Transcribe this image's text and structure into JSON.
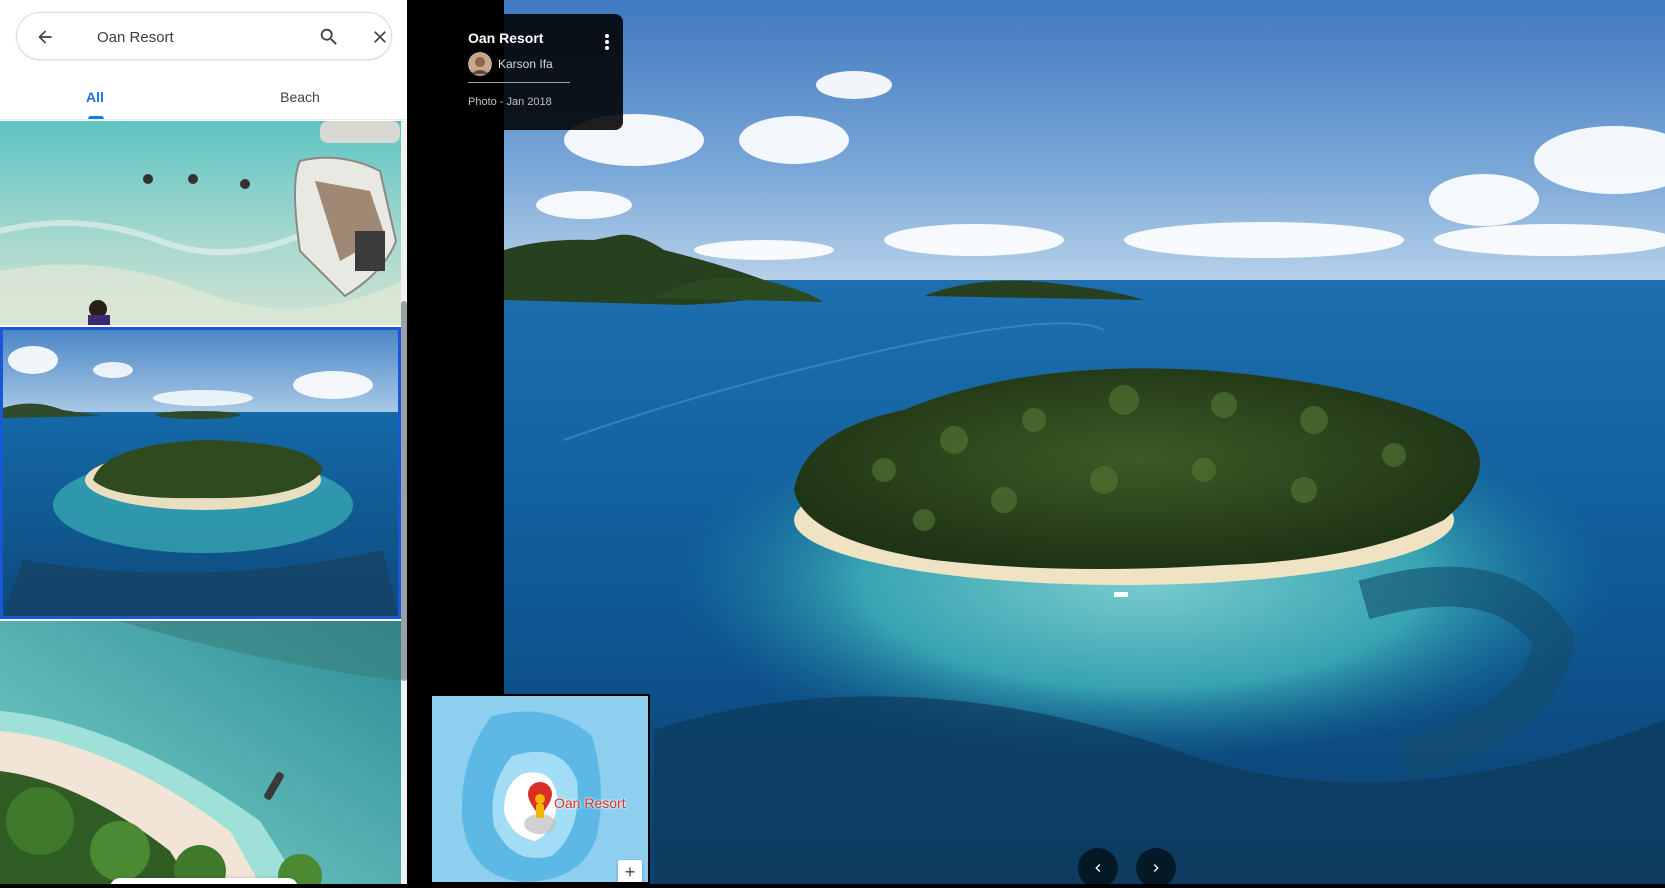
{
  "search": {
    "value": "Oan Resort",
    "back_icon": "arrow-left-icon",
    "search_icon": "search-icon",
    "close_icon": "close-icon"
  },
  "tabs": [
    {
      "label": "All",
      "active": true
    },
    {
      "label": "Beach",
      "active": false
    }
  ],
  "thumbnails": [
    {
      "description_icon": "beach-swimmers-photo",
      "selected": false
    },
    {
      "description_icon": "island-aerial-photo",
      "selected": true
    },
    {
      "description_icon": "beach-palms-photo",
      "selected": false
    }
  ],
  "photo_info": {
    "title": "Oan Resort",
    "author": "Karson Ifa",
    "meta": "Photo - Jan 2018",
    "more_icon": "more-vert-icon"
  },
  "minimap": {
    "place_label": "Oan Resort",
    "zoom_in_label": "+"
  },
  "navigation": {
    "prev_icon": "chevron-left-icon",
    "next_icon": "chevron-right-icon"
  },
  "colors": {
    "accent": "#1a73e8",
    "selected_border": "#1a57d6",
    "pin": "#d93025"
  }
}
